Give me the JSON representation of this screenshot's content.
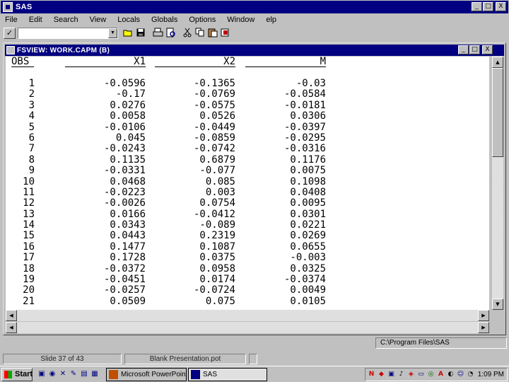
{
  "window": {
    "title": "SAS",
    "minimize": "_",
    "maximize": "□",
    "close": "X"
  },
  "menu": [
    "File",
    "Edit",
    "Search",
    "View",
    "Locals",
    "Globals",
    "Options",
    "Window",
    "elp"
  ],
  "toolbar": {
    "check": "✓",
    "command_value": "",
    "dropdown": "▼"
  },
  "child_window": {
    "title": "FSVIEW:  WORK.CAPM (B)",
    "minimize": "_",
    "maximize": "□",
    "close": "X"
  },
  "table": {
    "columns": [
      "OBS",
      "X1",
      "X2",
      "M"
    ],
    "rows": [
      [
        "1",
        "-0.0596",
        "-0.1365",
        "-0.03"
      ],
      [
        "2",
        "-0.17",
        "-0.0769",
        "-0.0584"
      ],
      [
        "3",
        "0.0276",
        "-0.0575",
        "-0.0181"
      ],
      [
        "4",
        "0.0058",
        "0.0526",
        "0.0306"
      ],
      [
        "5",
        "-0.0106",
        "-0.0449",
        "-0.0397"
      ],
      [
        "6",
        "0.045",
        "-0.0859",
        "-0.0295"
      ],
      [
        "7",
        "-0.0243",
        "-0.0742",
        "-0.0316"
      ],
      [
        "8",
        "0.1135",
        "0.6879",
        "0.1176"
      ],
      [
        "9",
        "-0.0331",
        "-0.077",
        "0.0075"
      ],
      [
        "10",
        "0.0468",
        "0.085",
        "0.1098"
      ],
      [
        "11",
        "-0.0223",
        "0.003",
        "0.0408"
      ],
      [
        "12",
        "-0.0026",
        "0.0754",
        "0.0095"
      ],
      [
        "13",
        "0.0166",
        "-0.0412",
        "0.0301"
      ],
      [
        "14",
        "0.0343",
        "-0.089",
        "0.0221"
      ],
      [
        "15",
        "0.0443",
        "0.2319",
        "0.0269"
      ],
      [
        "16",
        "0.1477",
        "0.1087",
        "0.0655"
      ],
      [
        "17",
        "0.1728",
        "0.0375",
        "-0.003"
      ],
      [
        "18",
        "-0.0372",
        "0.0958",
        "0.0325"
      ],
      [
        "19",
        "-0.0451",
        "0.0174",
        "-0.0374"
      ],
      [
        "20",
        "-0.0257",
        "-0.0724",
        "0.0049"
      ],
      [
        "21",
        "0.0509",
        "0.075",
        "0.0105"
      ]
    ]
  },
  "status": {
    "path": "C:\\Program Files\\SAS"
  },
  "ppt_status": {
    "slide": "Slide 37 of 43",
    "template": "Blank Presentation.pot"
  },
  "taskbar": {
    "start": "Start",
    "tasks": [
      {
        "label": "Microsoft PowerPoint"
      },
      {
        "label": "SAS"
      }
    ],
    "clock": "1:09 PM"
  },
  "colors": {
    "title_bar": "#000080",
    "face": "#c0c0c0",
    "view_bg": "#ffffff"
  }
}
